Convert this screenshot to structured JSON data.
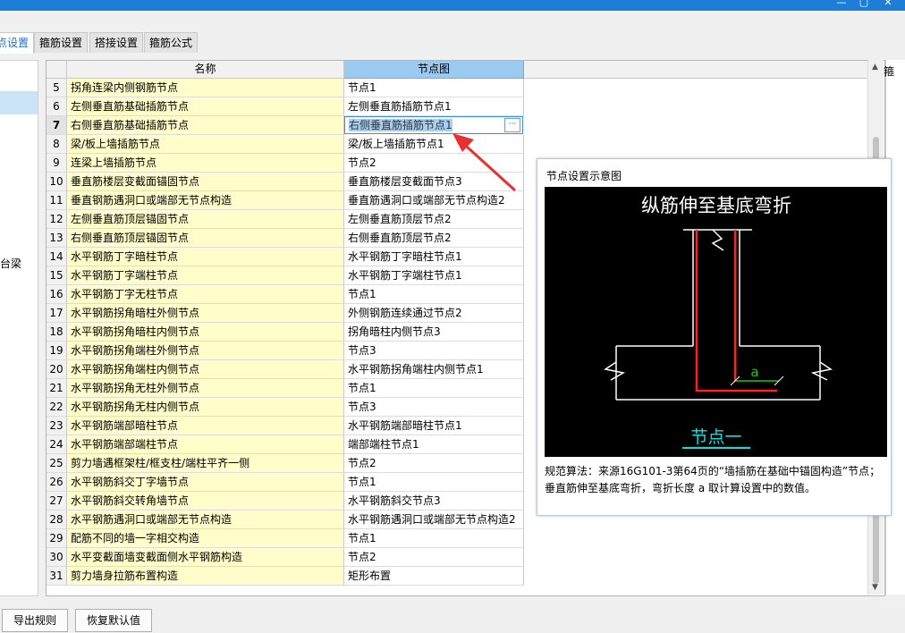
{
  "window": {
    "minimize": "▢",
    "close": "✕"
  },
  "tabs": [
    {
      "label": "节点设置"
    },
    {
      "label": "箍筋设置"
    },
    {
      "label": "搭接设置"
    },
    {
      "label": "箍筋公式"
    }
  ],
  "left_panel": {
    "partial_text": "承台梁"
  },
  "grid": {
    "headers": {
      "name": "名称",
      "node": "节点图"
    },
    "right_edge_text": "箍",
    "rows": [
      {
        "num": "5",
        "name": "拐角连梁内侧钢筋节点",
        "node": "节点1"
      },
      {
        "num": "6",
        "name": "左侧垂直筋基础插筋节点",
        "node": "左侧垂直筋插筋节点1"
      },
      {
        "num": "7",
        "name": "右侧垂直筋基础插筋节点",
        "node": "右侧垂直筋插筋节点1"
      },
      {
        "num": "8",
        "name": "梁/板上墙插筋节点",
        "node": "梁/板上墙插筋节点1"
      },
      {
        "num": "9",
        "name": "连梁上墙插筋节点",
        "node": "节点2"
      },
      {
        "num": "10",
        "name": "垂直筋楼层变截面锚固节点",
        "node": "垂直筋楼层变截面节点3"
      },
      {
        "num": "11",
        "name": "垂直钢筋遇洞口或端部无节点构造",
        "node": "垂直筋遇洞口或端部无节点构造2"
      },
      {
        "num": "12",
        "name": "左侧垂直筋顶层锚固节点",
        "node": "左侧垂直筋顶层节点2"
      },
      {
        "num": "13",
        "name": "右侧垂直筋顶层锚固节点",
        "node": "右侧垂直筋顶层节点2"
      },
      {
        "num": "14",
        "name": "水平钢筋丁字暗柱节点",
        "node": "水平钢筋丁字暗柱节点1"
      },
      {
        "num": "15",
        "name": "水平钢筋丁字端柱节点",
        "node": "水平钢筋丁字端柱节点1"
      },
      {
        "num": "16",
        "name": "水平钢筋丁字无柱节点",
        "node": "节点1"
      },
      {
        "num": "17",
        "name": "水平钢筋拐角暗柱外侧节点",
        "node": "外侧钢筋连续通过节点2"
      },
      {
        "num": "18",
        "name": "水平钢筋拐角暗柱内侧节点",
        "node": "拐角暗柱内侧节点3"
      },
      {
        "num": "19",
        "name": "水平钢筋拐角端柱外侧节点",
        "node": "节点3"
      },
      {
        "num": "20",
        "name": "水平钢筋拐角端柱内侧节点",
        "node": "水平钢筋拐角端柱内侧节点1"
      },
      {
        "num": "21",
        "name": "水平钢筋拐角无柱外侧节点",
        "node": "节点1"
      },
      {
        "num": "22",
        "name": "水平钢筋拐角无柱内侧节点",
        "node": "节点3"
      },
      {
        "num": "23",
        "name": "水平钢筋端部暗柱节点",
        "node": "水平钢筋端部暗柱节点1"
      },
      {
        "num": "24",
        "name": "水平钢筋端部端柱节点",
        "node": "端部端柱节点1"
      },
      {
        "num": "25",
        "name": "剪力墙遇框架柱/框支柱/端柱平齐一侧",
        "node": "节点2"
      },
      {
        "num": "26",
        "name": "水平钢筋斜交丁字墙节点",
        "node": "节点1"
      },
      {
        "num": "27",
        "name": "水平钢筋斜交转角墙节点",
        "node": "水平钢筋斜交节点3"
      },
      {
        "num": "28",
        "name": "水平钢筋遇洞口或端部无节点构造",
        "node": "水平钢筋遇洞口或端部无节点构造2"
      },
      {
        "num": "29",
        "name": "配筋不同的墙一字相交构造",
        "node": "节点1"
      },
      {
        "num": "30",
        "name": "水平变截面墙变截面侧水平钢筋构造",
        "node": "节点2"
      },
      {
        "num": "31",
        "name": "剪力墙身拉筋布置构造",
        "node": "矩形布置"
      }
    ],
    "ellipsis_label": "···"
  },
  "preview": {
    "title": "节点设置示意图",
    "diagram_title": "纵筋伸至基底弯折",
    "diagram_label_a": "a",
    "diagram_caption": "节点一",
    "description": "规范算法：来源16G101-3第64页的“墙插筋在基础中锚固构造”节点；垂直筋伸至基底弯折，弯折长度 a 取计算设置中的数值。"
  },
  "buttons": {
    "export": "导出规则",
    "restore": "恢复默认值"
  },
  "colors": {
    "name_cell_bg": "#fffecb",
    "header_selected": "#9cc9ef",
    "arrow": "#e83030",
    "rebar": "#ff2020",
    "dim_line": "#19c819",
    "caption": "#00e5e5"
  }
}
